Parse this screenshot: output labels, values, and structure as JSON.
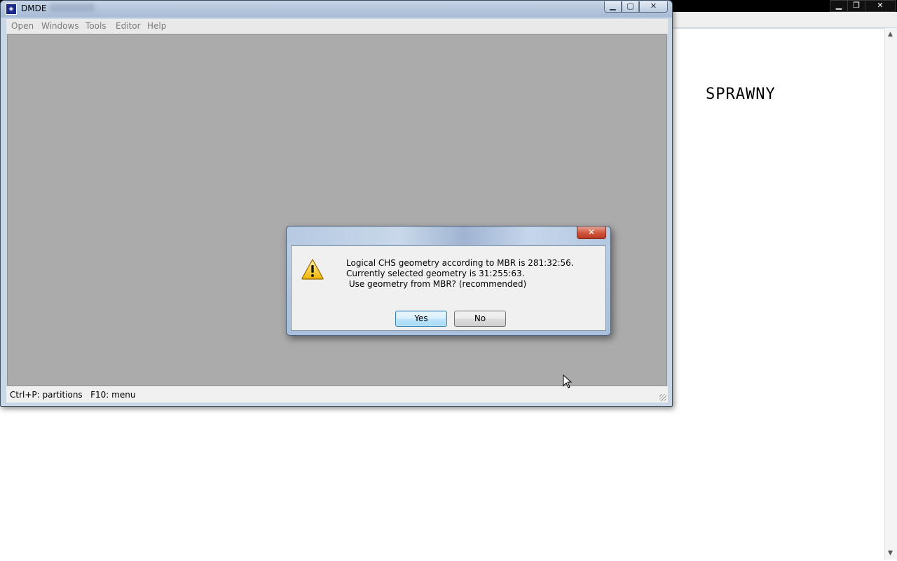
{
  "background_window": {
    "controls": {
      "minimize": "▁",
      "restore": "❐",
      "close": "✕"
    },
    "document_text": "SPRAWNY",
    "scroll_up": "▲",
    "scroll_down": "▼"
  },
  "dmde": {
    "app_icon_glyph": "◈",
    "title": "DMDE",
    "controls": {
      "minimize": "▁",
      "maximize": "▢",
      "close": "✕"
    },
    "menu": [
      "Open",
      "Windows",
      "Tools",
      "Editor",
      "Help"
    ],
    "status": "Ctrl+P: partitions   F10: menu"
  },
  "dialog": {
    "close_glyph": "✕",
    "icon": "warning-icon",
    "lines": [
      "Logical CHS geometry according to MBR is 281:32:56.",
      "Currently selected geometry is 31:255:63.",
      " Use geometry from MBR? (recommended)"
    ],
    "yes_label": "Yes",
    "no_label": "No"
  }
}
